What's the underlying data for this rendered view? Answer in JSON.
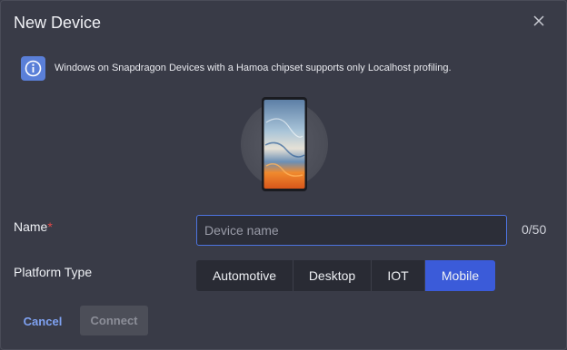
{
  "dialog": {
    "title": "New Device",
    "close_icon": "close-icon",
    "info": {
      "icon": "info-icon",
      "text": "Windows on Snapdragon Devices with a Hamoa chipset supports only Localhost profiling."
    },
    "illustration_icon": "mobile-phone-icon",
    "name_field": {
      "label": "Name",
      "required_marker": "*",
      "placeholder": "Device name",
      "value": "",
      "counter": "0/50"
    },
    "platform_type": {
      "label": "Platform Type",
      "options": [
        "Automotive",
        "Desktop",
        "IOT",
        "Mobile"
      ],
      "selected": "Mobile"
    },
    "buttons": {
      "cancel": "Cancel",
      "connect": "Connect"
    },
    "colors": {
      "accent": "#3b5bd9",
      "link": "#7fa2f2",
      "required": "#e04848",
      "background": "#393b47"
    }
  }
}
